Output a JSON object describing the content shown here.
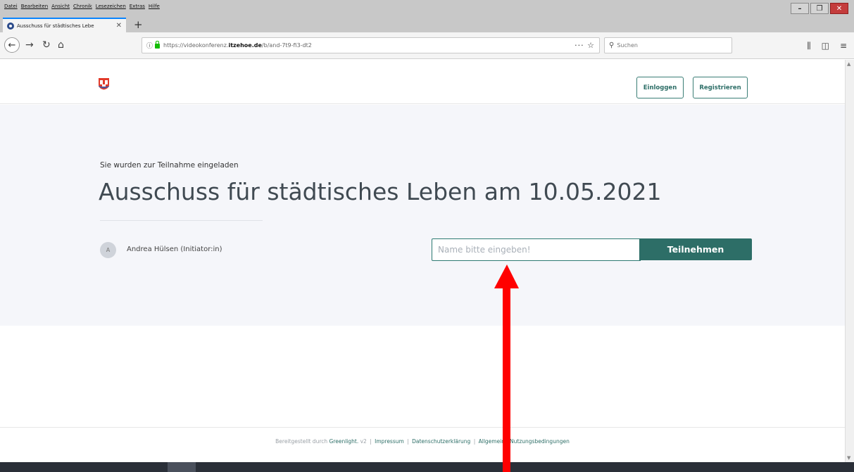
{
  "browser": {
    "menu": [
      "Datei",
      "Bearbeiten",
      "Ansicht",
      "Chronik",
      "Lesezeichen",
      "Extras",
      "Hilfe"
    ],
    "tab_title": "Ausschuss für städtisches Lebe",
    "url_prefix": "https://videokonferenz.",
    "url_host": "itzehoe.de",
    "url_path": "/b/and-7t9-fi3-dt2",
    "search_placeholder": "Suchen"
  },
  "header": {
    "login_label": "Einloggen",
    "register_label": "Registrieren"
  },
  "room": {
    "invite_text": "Sie wurden zur Teilnahme eingeladen",
    "title": "Ausschuss für städtisches Leben am 10.05.2021",
    "owner_initial": "A",
    "owner_name": "Andrea Hülsen (Initiator:in)",
    "name_placeholder": "Name bitte eingeben!",
    "join_label": "Teilnehmen"
  },
  "footer": {
    "prefix": "Bereitgestellt durch ",
    "greenlight": "Greenlight.",
    "version": " v2 ",
    "impressum": "Impressum",
    "datenschutz": "Datenschutzerklärung",
    "agb": "Allgemeine Nutzungsbedingungen"
  },
  "colors": {
    "accent": "#2d6e67",
    "hero_bg": "#f5f6fa",
    "annotation": "#ff0000"
  }
}
